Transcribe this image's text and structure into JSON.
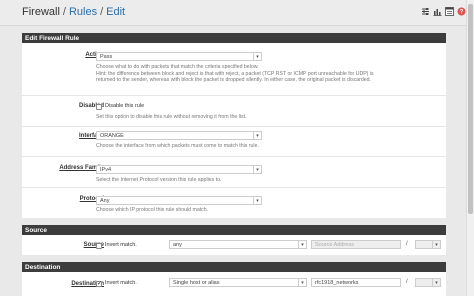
{
  "breadcrumb": {
    "firewall": "Firewall",
    "rules": "Rules",
    "edit": "Edit",
    "sep": "/"
  },
  "top_icons": [
    "sliders-icon",
    "bar-chart-icon",
    "list-icon",
    "help-icon"
  ],
  "colors": {
    "panel_header": "#3c3c3c",
    "link": "#2a6ea8",
    "help_icon": "#d9534f"
  },
  "edit_panel": {
    "title": "Edit Firewall Rule",
    "action": {
      "label": "Action",
      "value": "Pass",
      "help1": "Choose what to do with packets that match the criteria specified below.",
      "help2": "Hint: the difference between block and reject is that with reject, a packet (TCP RST or ICMP port unreachable for UDP) is",
      "help3": "returned to the sender, whereas with block the packet is dropped silently. In either case, the original packet is discarded."
    },
    "disabled": {
      "label": "Disabled",
      "checkbox_label": "Disable this rule",
      "help": "Set this option to disable this rule without removing it from the list."
    },
    "interface": {
      "label": "Interface",
      "value": "ORANGE",
      "help": "Choose the interface from which packets must come to match this rule."
    },
    "address_family": {
      "label": "Address Family",
      "value": "IPv4",
      "help": "Select the Internet Protocol version this rule applies to."
    },
    "protocol": {
      "label": "Protocol",
      "value": "Any",
      "help": "Choose which IP protocol this rule should match."
    }
  },
  "source_panel": {
    "title": "Source",
    "label": "Source",
    "invert_label": "Invert match.",
    "type": "any",
    "address_placeholder": "Source Address",
    "slash": "/"
  },
  "destination_panel": {
    "title": "Destination",
    "label": "Destination",
    "invert_label": "Invert match.",
    "type": "Single host or alias",
    "address": "rfc1918_networks",
    "slash": "/"
  }
}
